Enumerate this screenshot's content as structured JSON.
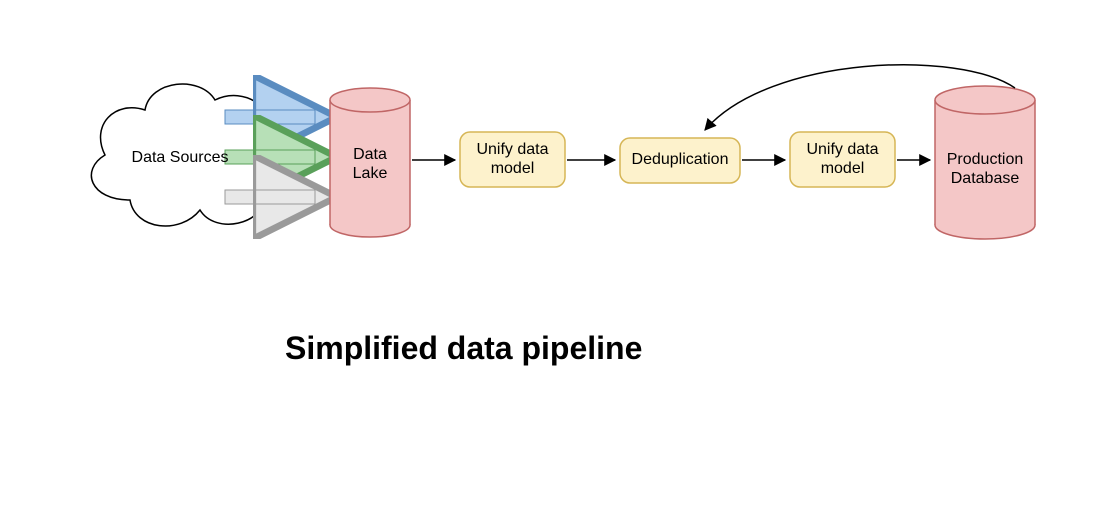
{
  "diagram": {
    "title": "Simplified data pipeline",
    "nodes": {
      "sources": {
        "label": "Data Sources"
      },
      "lake": {
        "label1": "Data",
        "label2": "Lake"
      },
      "unify1": {
        "label1": "Unify data",
        "label2": "model"
      },
      "dedup": {
        "label": "Deduplication"
      },
      "unify2": {
        "label1": "Unify data",
        "label2": "model"
      },
      "production": {
        "label1": "Production",
        "label2": "Database"
      }
    },
    "colors": {
      "cylinder_fill": "#f4c7c7",
      "cylinder_stroke": "#c06666",
      "box_fill": "#fdf2cc",
      "box_stroke": "#d6b656",
      "arrow_blue": "#b3d1f0",
      "arrow_green": "#b7e0b7",
      "arrow_gray": "#e8e8e8",
      "arrow_dark": "#000000"
    }
  }
}
